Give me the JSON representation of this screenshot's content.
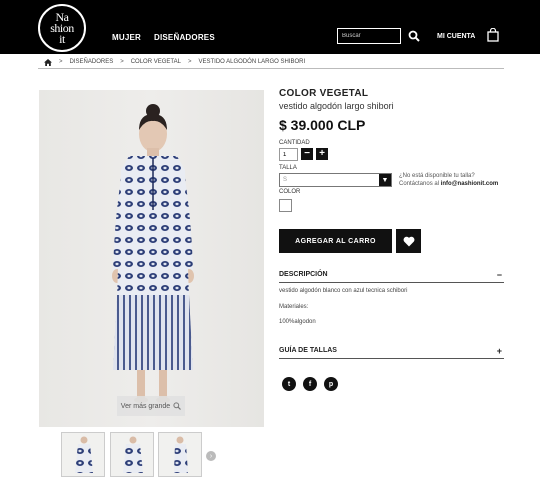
{
  "header": {
    "logo": {
      "line1": "Na",
      "line2": "shion",
      "line3": "it"
    },
    "nav": {
      "women": "MUJER",
      "designers": "DISEÑADORES"
    },
    "search_placeholder": "Buscar",
    "account": "MI CUENTA"
  },
  "breadcrumb": {
    "items": [
      "DISEÑADORES",
      "COLOR VEGETAL",
      "VESTIDO ALGODÓN LARGO SHIBORI"
    ]
  },
  "gallery": {
    "zoom_label": "Ver más grande"
  },
  "product": {
    "brand": "COLOR VEGETAL",
    "name": "vestido algodón largo shibori",
    "price": "$ 39.000 CLP",
    "quantity_label": "CANTIDAD",
    "quantity_value": "1",
    "size_label": "TALLA",
    "size_value": "S",
    "size_help_line1": "¿No está disponible tu talla?",
    "size_help_line2": "Contáctanos al",
    "size_help_email": "info@nashionit.com",
    "color_label": "COLOR",
    "add_to_cart": "AGREGAR AL CARRO"
  },
  "description": {
    "title": "DESCRIPCIÓN",
    "toggle": "−",
    "lines": [
      "vestido algodón blanco  con azul tecnica schibori",
      "Materiales:",
      "100%algodon"
    ]
  },
  "size_guide": {
    "title": "GUÍA DE TALLAS",
    "toggle": "+"
  },
  "social": {
    "twitter": "t",
    "facebook": "f",
    "pinterest": "p"
  },
  "colors": {
    "header_bg": "#000000",
    "button_bg": "#111111",
    "dress_blue": "#2e3f78"
  }
}
